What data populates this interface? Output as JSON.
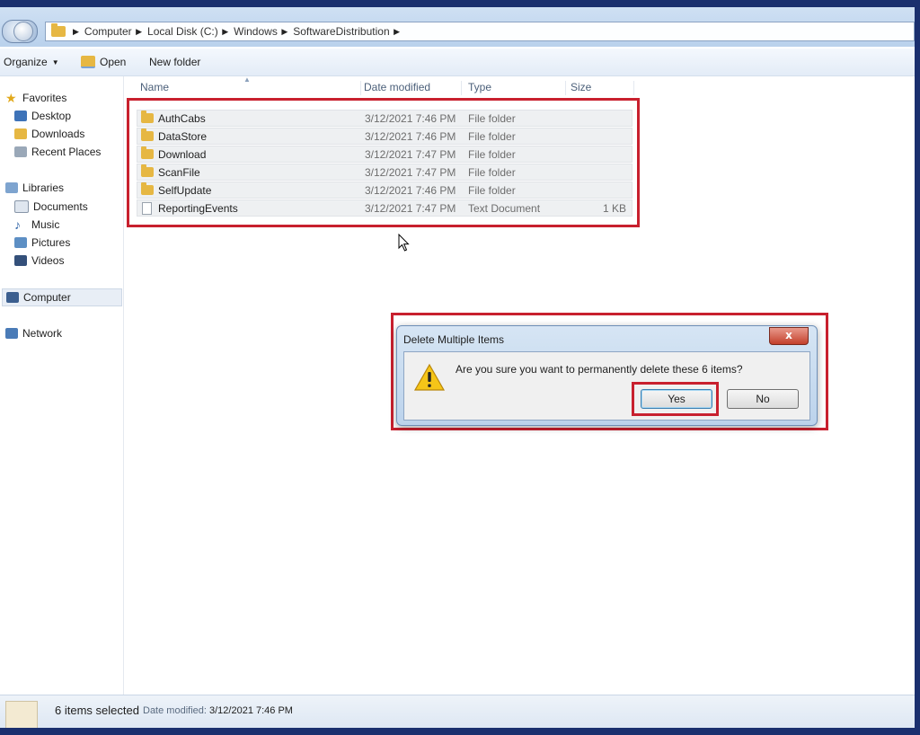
{
  "breadcrumb": [
    "Computer",
    "Local Disk (C:)",
    "Windows",
    "SoftwareDistribution"
  ],
  "toolbar": {
    "organize": "Organize",
    "open": "Open",
    "new_folder": "New folder"
  },
  "nav": {
    "favorites": "Favorites",
    "desktop": "Desktop",
    "downloads": "Downloads",
    "recent_places": "Recent Places",
    "libraries": "Libraries",
    "documents": "Documents",
    "music": "Music",
    "pictures": "Pictures",
    "videos": "Videos",
    "computer": "Computer",
    "network": "Network"
  },
  "columns": {
    "name": "Name",
    "date": "Date modified",
    "type": "Type",
    "size": "Size"
  },
  "files": [
    {
      "name": "AuthCabs",
      "date": "3/12/2021 7:46 PM",
      "type": "File folder",
      "size": "",
      "icon": "folder-icon"
    },
    {
      "name": "DataStore",
      "date": "3/12/2021 7:46 PM",
      "type": "File folder",
      "size": "",
      "icon": "folder-icon"
    },
    {
      "name": "Download",
      "date": "3/12/2021 7:47 PM",
      "type": "File folder",
      "size": "",
      "icon": "folder-icon"
    },
    {
      "name": "ScanFile",
      "date": "3/12/2021 7:47 PM",
      "type": "File folder",
      "size": "",
      "icon": "folder-icon"
    },
    {
      "name": "SelfUpdate",
      "date": "3/12/2021 7:46 PM",
      "type": "File folder",
      "size": "",
      "icon": "folder-icon"
    },
    {
      "name": "ReportingEvents",
      "date": "3/12/2021 7:47 PM",
      "type": "Text Document",
      "size": "1 KB",
      "icon": "text-document-icon"
    }
  ],
  "dialog": {
    "title": "Delete Multiple Items",
    "close": "x",
    "message": "Are you sure you want to permanently delete these 6 items?",
    "yes": "Yes",
    "no": "No"
  },
  "status": {
    "selected": "6 items selected",
    "modified_label": "Date modified:",
    "modified_value": "3/12/2021 7:46 PM"
  },
  "colors": {
    "highlight": "#c8202e",
    "folder": "#e6b743",
    "window_frame": "#1a2f6e"
  }
}
